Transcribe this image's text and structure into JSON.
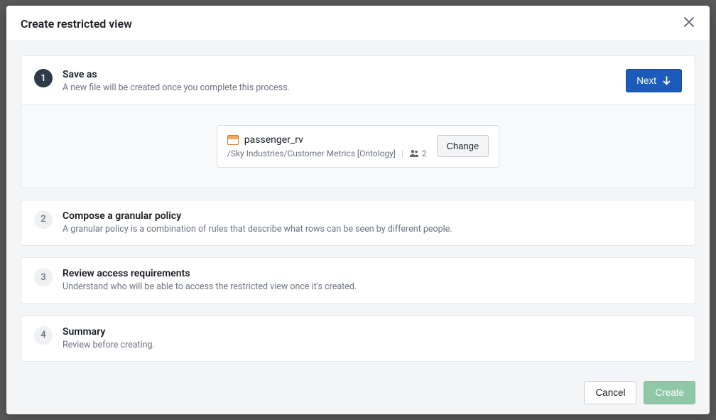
{
  "dialog": {
    "title": "Create restricted view"
  },
  "steps": {
    "s1": {
      "num": "1",
      "title": "Save as",
      "desc": "A new file will be created once you complete this process.",
      "next_label": "Next"
    },
    "s2": {
      "num": "2",
      "title": "Compose a granular policy",
      "desc": "A granular policy is a combination of rules that describe what rows can be seen by different people."
    },
    "s3": {
      "num": "3",
      "title": "Review access requirements",
      "desc": "Understand who will be able to access the restricted view once it's created."
    },
    "s4": {
      "num": "4",
      "title": "Summary",
      "desc": "Review before creating."
    }
  },
  "file": {
    "name": "passenger_rv",
    "path": "/Sky Industries/Customer Metrics [Ontology]",
    "user_count": "2",
    "change_label": "Change"
  },
  "footer": {
    "cancel": "Cancel",
    "create": "Create"
  }
}
